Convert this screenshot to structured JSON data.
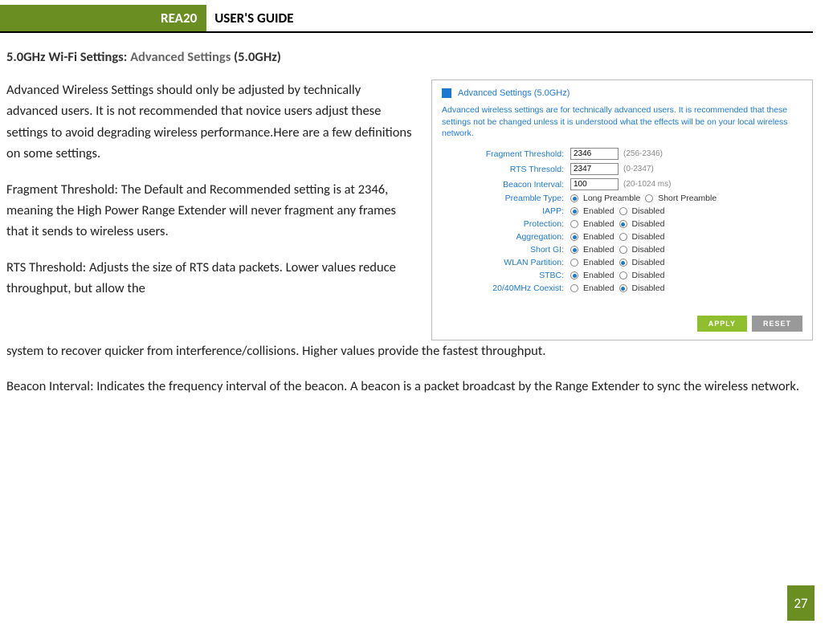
{
  "header": {
    "product": "REA20",
    "title": "USER'S GUIDE"
  },
  "section": {
    "prefix": "5.0GHz Wi-Fi Settings:",
    "grey": "Advanced Settings",
    "suffix": "(5.0GHz)"
  },
  "paragraphs": {
    "p1": "Advanced Wireless Settings should only be adjusted by technically advanced users. It is not recommended that novice users adjust these settings to avoid degrading wireless performance.Here are a few definitions on some settings.",
    "p2": "Fragment Threshold: The Default and Recommended setting is at 2346, meaning the High Power Range Extender will never fragment any frames that it sends to wireless users.",
    "p3a": "RTS Threshold: Adjusts the size of RTS data packets. Lower values reduce throughput, but allow the",
    "p3b": "system to recover quicker from interference/collisions. Higher values provide the fastest throughput.",
    "p4": "Beacon Interval: Indicates the frequency interval of the beacon. A beacon is a packet broadcast by the Range Extender to sync the wireless network."
  },
  "panel": {
    "title": "Advanced Settings (5.0GHz)",
    "desc": "Advanced wireless settings are for technically advanced users. It is recommended that these settings not be changed unless it is understood what the effects will be on your local wireless network.",
    "fields": {
      "fragment": {
        "label": "Fragment Threshold:",
        "value": "2346",
        "hint": "(256-2346)"
      },
      "rts": {
        "label": "RTS Thresold:",
        "value": "2347",
        "hint": "(0-2347)"
      },
      "beacon": {
        "label": "Beacon Interval:",
        "value": "100",
        "hint": "(20-1024 ms)"
      },
      "preamble": {
        "label": "Preamble Type:",
        "opt1": "Long Preamble",
        "opt2": "Short Preamble",
        "selected": 1
      },
      "iapp": {
        "label": "IAPP:",
        "opt1": "Enabled",
        "opt2": "Disabled",
        "selected": 1
      },
      "protection": {
        "label": "Protection:",
        "opt1": "Enabled",
        "opt2": "Disabled",
        "selected": 2
      },
      "aggregation": {
        "label": "Aggregation:",
        "opt1": "Enabled",
        "opt2": "Disabled",
        "selected": 1
      },
      "shortgi": {
        "label": "Short GI:",
        "opt1": "Enabled",
        "opt2": "Disabled",
        "selected": 1
      },
      "wlan": {
        "label": "WLAN Partition:",
        "opt1": "Enabled",
        "opt2": "Disabled",
        "selected": 2
      },
      "stbc": {
        "label": "STBC:",
        "opt1": "Enabled",
        "opt2": "Disabled",
        "selected": 1
      },
      "coexist": {
        "label": "20/40MHz Coexist:",
        "opt1": "Enabled",
        "opt2": "Disabled",
        "selected": 2
      }
    },
    "buttons": {
      "apply": "APPLY",
      "reset": "RESET"
    }
  },
  "page_number": "27"
}
